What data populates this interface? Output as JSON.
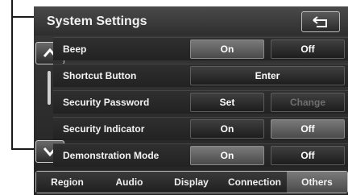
{
  "header": {
    "title": "System Settings",
    "back_icon": "return-arrow-icon"
  },
  "scroll": {
    "up_icon": "chevron-up-icon",
    "down_icon": "chevron-down-icon"
  },
  "rows": [
    {
      "label": "Beep",
      "opt1": "On",
      "opt2": "Off",
      "selected": "On"
    },
    {
      "label": "Shortcut Button",
      "action": "Enter"
    },
    {
      "label": "Security Password",
      "opt1": "Set",
      "opt2": "Change",
      "disabled": "Change"
    },
    {
      "label": "Security Indicator",
      "opt1": "On",
      "opt2": "Off",
      "selected": "Off"
    },
    {
      "label": "Demonstration Mode",
      "opt1": "On",
      "opt2": "Off",
      "selected": "On"
    }
  ],
  "tabs": [
    {
      "label": "Region"
    },
    {
      "label": "Audio"
    },
    {
      "label": "Display"
    },
    {
      "label": "Connection"
    },
    {
      "label": "Others",
      "active": true
    }
  ]
}
